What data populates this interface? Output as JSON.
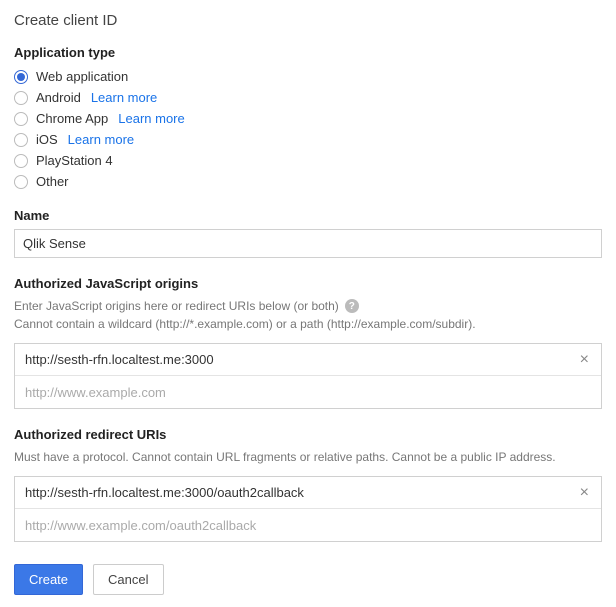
{
  "title": "Create client ID",
  "appType": {
    "label": "Application type",
    "learnMore": "Learn more",
    "options": [
      {
        "label": "Web application",
        "selected": true,
        "learnMore": false
      },
      {
        "label": "Android",
        "selected": false,
        "learnMore": true
      },
      {
        "label": "Chrome App",
        "selected": false,
        "learnMore": true
      },
      {
        "label": "iOS",
        "selected": false,
        "learnMore": true
      },
      {
        "label": "PlayStation 4",
        "selected": false,
        "learnMore": false
      },
      {
        "label": "Other",
        "selected": false,
        "learnMore": false
      }
    ]
  },
  "nameField": {
    "label": "Name",
    "value": "Qlik Sense"
  },
  "jsOrigins": {
    "label": "Authorized JavaScript origins",
    "help1": "Enter JavaScript origins here or redirect URIs below (or both)",
    "help2": "Cannot contain a wildcard (http://*.example.com) or a path (http://example.com/subdir).",
    "entries": [
      "http://sesth-rfn.localtest.me:3000"
    ],
    "placeholder": "http://www.example.com"
  },
  "redirectUris": {
    "label": "Authorized redirect URIs",
    "help": "Must have a protocol. Cannot contain URL fragments or relative paths. Cannot be a public IP address.",
    "entries": [
      "http://sesth-rfn.localtest.me:3000/oauth2callback"
    ],
    "placeholder": "http://www.example.com/oauth2callback"
  },
  "buttons": {
    "create": "Create",
    "cancel": "Cancel"
  }
}
